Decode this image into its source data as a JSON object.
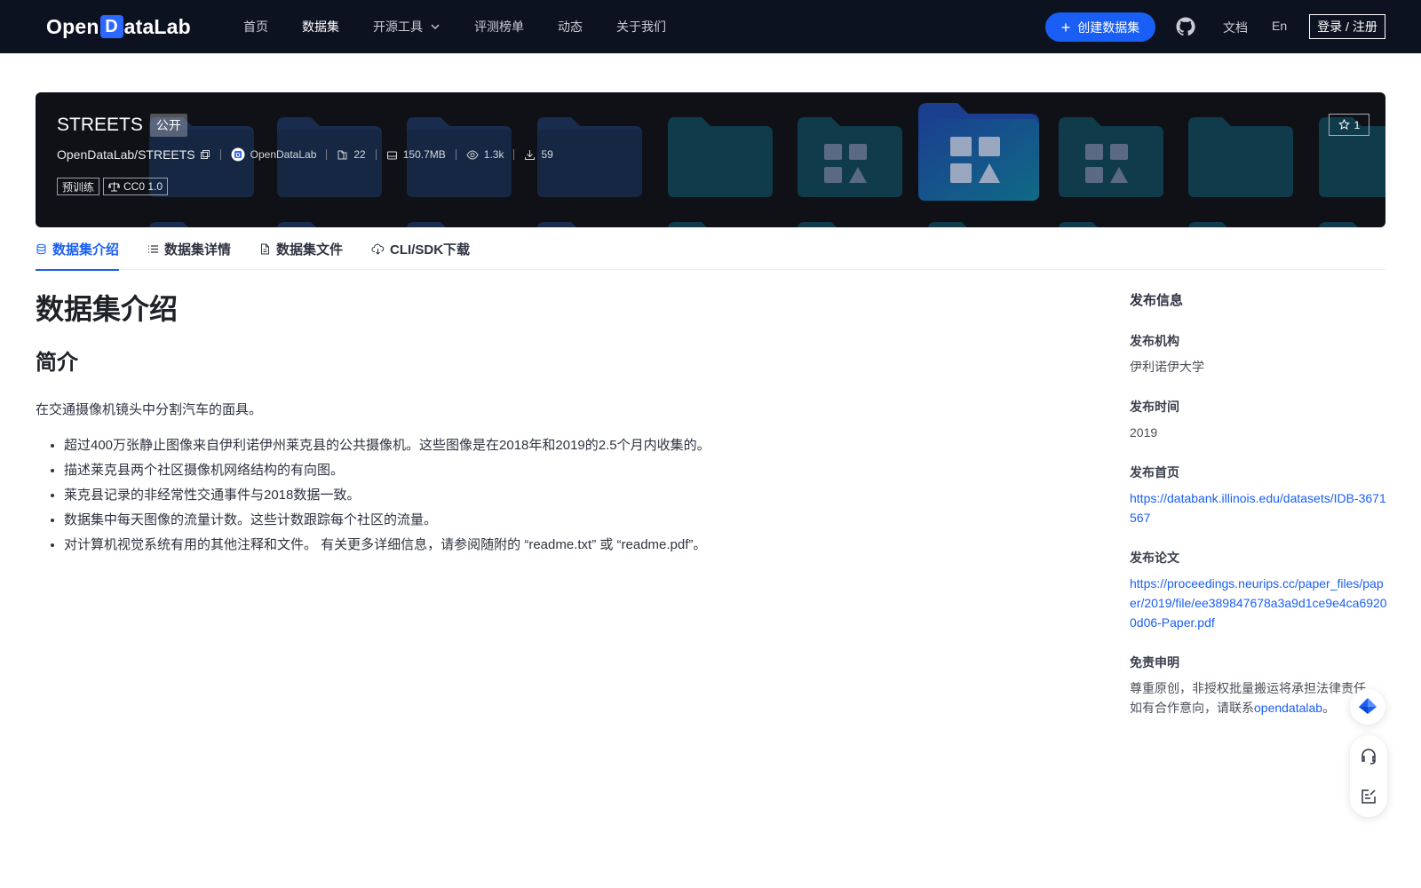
{
  "nav": {
    "logo_pre": "Open",
    "logo_d": "D",
    "logo_post": "ataLab",
    "items": [
      {
        "label": "首页"
      },
      {
        "label": "数据集"
      },
      {
        "label": "开源工具"
      },
      {
        "label": "评测榜单"
      },
      {
        "label": "动态"
      },
      {
        "label": "关于我们"
      }
    ],
    "create_label": "创建数据集",
    "docs_label": "文档",
    "lang_label": "En",
    "login_label": "登录 / 注册"
  },
  "dataset": {
    "name": "STREETS",
    "visibility": "公开",
    "repo": "OpenDataLab/STREETS",
    "publisher": "OpenDataLab",
    "files": "22",
    "size": "150.7MB",
    "views": "1.3k",
    "downloads": "59",
    "tags": [
      "预训练",
      "CC0 1.0"
    ],
    "stars": "1"
  },
  "tabs": [
    {
      "label": "数据集介绍"
    },
    {
      "label": "数据集详情"
    },
    {
      "label": "数据集文件"
    },
    {
      "label": "CLI/SDK下载"
    }
  ],
  "content": {
    "title": "数据集介绍",
    "section": "简介",
    "intro": "在交通摄像机镜头中分割汽车的面具。",
    "bullets": [
      "超过400万张静止图像来自伊利诺伊州莱克县的公共摄像机。这些图像是在2018年和2019的2.5个月内收集的。",
      "描述莱克县两个社区摄像机网络结构的有向图。",
      "莱克县记录的非经常性交通事件与2018数据一致。",
      "数据集中每天图像的流量计数。这些计数跟踪每个社区的流量。",
      "对计算机视觉系统有用的其他注释和文件。 有关更多详细信息，请参阅随附的 “readme.txt” 或 “readme.pdf”。"
    ]
  },
  "sidebar": {
    "title": "发布信息",
    "org_label": "发布机构",
    "org_value": "伊利诺伊大学",
    "time_label": "发布时间",
    "time_value": "2019",
    "home_label": "发布首页",
    "home_value": "https://databank.illinois.edu/datasets/IDB-3671567",
    "paper_label": "发布论文",
    "paper_value": "https://proceedings.neurips.cc/paper_files/paper/2019/file/ee389847678a3a9d1ce9e4ca69200d06-Paper.pdf",
    "disclaimer_label": "免责申明",
    "disclaimer_line1": "尊重原创，非授权批量搬运将承担法律责任。",
    "disclaimer_line2_pre": "如有合作意向，请联系",
    "disclaimer_link": "opendatalab",
    "disclaimer_line2_post": "。"
  },
  "colors": {
    "accent": "#1a5ff5",
    "nav_bg": "#0d1220",
    "banner_bg": "#0f1116"
  }
}
